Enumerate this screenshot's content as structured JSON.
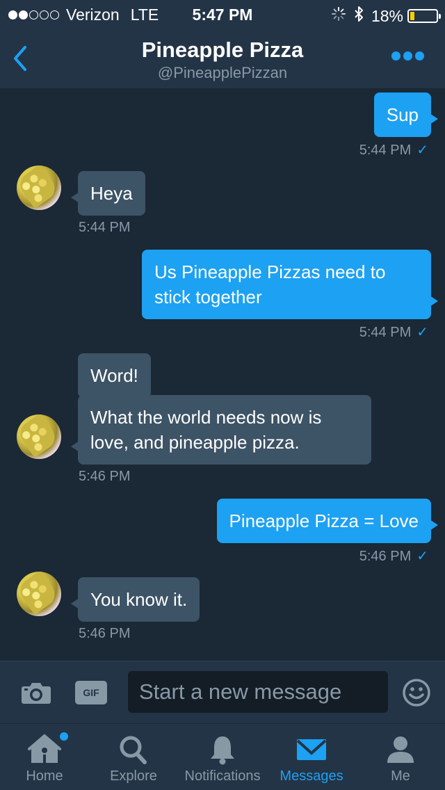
{
  "status_bar": {
    "carrier": "Verizon",
    "network": "LTE",
    "time": "5:47 PM",
    "battery_percent": "18%",
    "battery_level": 0.18,
    "signal_bars_filled": 2,
    "signal_bars_total": 5
  },
  "header": {
    "back_icon": "chevron-left-icon",
    "title": "Pineapple Pizza",
    "handle": "@PineapplePizzan",
    "more_icon": "more-dots-icon"
  },
  "messages": [
    {
      "direction": "outgoing",
      "text": "Sup",
      "time": "5:44 PM",
      "check": "✓"
    },
    {
      "direction": "incoming",
      "text": "Heya",
      "time": "5:44 PM"
    },
    {
      "direction": "outgoing",
      "text_line1": "Us Pineapple Pizzas need to",
      "text_line2": "stick together",
      "time": "5:44 PM",
      "check": "✓"
    },
    {
      "direction": "incoming",
      "text": "Word!"
    },
    {
      "direction": "incoming",
      "text_line1": "What the world needs now is",
      "text_line2": "love, and pineapple pizza.",
      "time": "5:46 PM"
    },
    {
      "direction": "outgoing",
      "text": "Pineapple Pizza = Love",
      "time": "5:46 PM",
      "check": "✓"
    },
    {
      "direction": "incoming",
      "text": "You know it.",
      "time": "5:46 PM"
    }
  ],
  "composer": {
    "camera_icon": "camera-icon",
    "gif_label": "GIF",
    "placeholder": "Start a new message",
    "emoji_icon": "emoji-icon"
  },
  "tabbar": {
    "tabs": [
      {
        "label": "Home",
        "icon": "home-icon",
        "active": false,
        "has_dot": true
      },
      {
        "label": "Explore",
        "icon": "search-icon",
        "active": false
      },
      {
        "label": "Notifications",
        "icon": "bell-icon",
        "active": false
      },
      {
        "label": "Messages",
        "icon": "envelope-icon",
        "active": true
      },
      {
        "label": "Me",
        "icon": "person-icon",
        "active": false
      }
    ]
  },
  "colors": {
    "background": "#1b2836",
    "bar": "#243447",
    "accent": "#1da1f2",
    "incoming_bubble": "#3d5366",
    "muted": "#8899a6"
  }
}
